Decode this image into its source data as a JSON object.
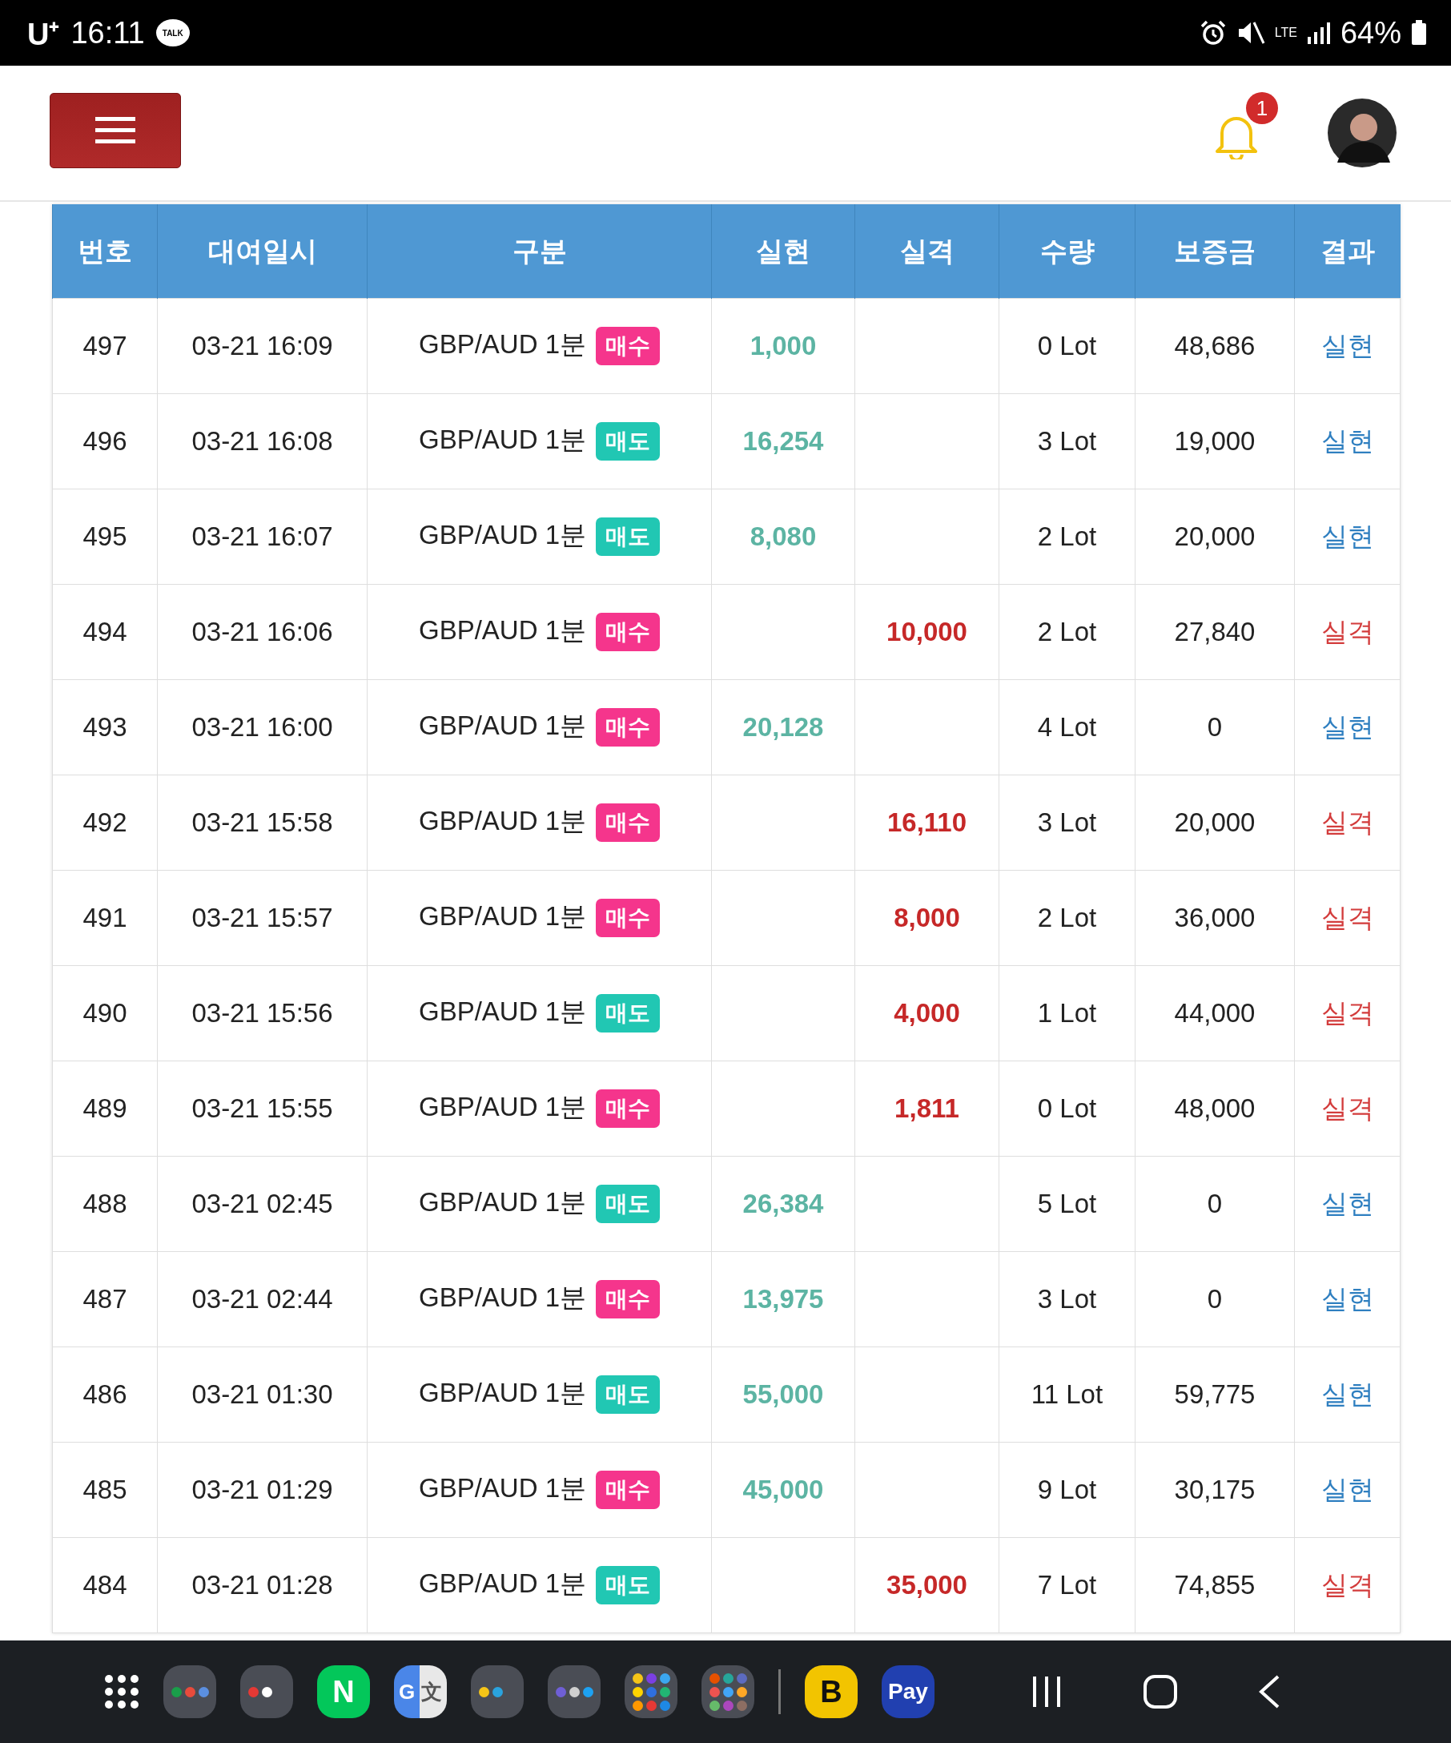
{
  "status_bar": {
    "carrier": "U⁺",
    "time": "16:11",
    "chat_badge": "TALK",
    "network": "LTE",
    "battery": "64%"
  },
  "header": {
    "notification_count": "1"
  },
  "table": {
    "columns": [
      "번호",
      "대여일시",
      "구분",
      "실현",
      "실격",
      "수량",
      "보증금",
      "결과"
    ],
    "rows": [
      {
        "no": "497",
        "datetime": "03-21 16:09",
        "instrument": "GBP/AUD 1분",
        "side": {
          "kind": "buy",
          "label": "매수"
        },
        "realized": "1,000",
        "disqualified": "",
        "quantity": "0 Lot",
        "deposit": "48,686",
        "result": {
          "kind": "win",
          "label": "실현"
        }
      },
      {
        "no": "496",
        "datetime": "03-21 16:08",
        "instrument": "GBP/AUD 1분",
        "side": {
          "kind": "sell",
          "label": "매도"
        },
        "realized": "16,254",
        "disqualified": "",
        "quantity": "3 Lot",
        "deposit": "19,000",
        "result": {
          "kind": "win",
          "label": "실현"
        }
      },
      {
        "no": "495",
        "datetime": "03-21 16:07",
        "instrument": "GBP/AUD 1분",
        "side": {
          "kind": "sell",
          "label": "매도"
        },
        "realized": "8,080",
        "disqualified": "",
        "quantity": "2 Lot",
        "deposit": "20,000",
        "result": {
          "kind": "win",
          "label": "실현"
        }
      },
      {
        "no": "494",
        "datetime": "03-21 16:06",
        "instrument": "GBP/AUD 1분",
        "side": {
          "kind": "buy",
          "label": "매수"
        },
        "realized": "",
        "disqualified": "10,000",
        "quantity": "2 Lot",
        "deposit": "27,840",
        "result": {
          "kind": "loss",
          "label": "실격"
        }
      },
      {
        "no": "493",
        "datetime": "03-21 16:00",
        "instrument": "GBP/AUD 1분",
        "side": {
          "kind": "buy",
          "label": "매수"
        },
        "realized": "20,128",
        "disqualified": "",
        "quantity": "4 Lot",
        "deposit": "0",
        "result": {
          "kind": "win",
          "label": "실현"
        }
      },
      {
        "no": "492",
        "datetime": "03-21 15:58",
        "instrument": "GBP/AUD 1분",
        "side": {
          "kind": "buy",
          "label": "매수"
        },
        "realized": "",
        "disqualified": "16,110",
        "quantity": "3 Lot",
        "deposit": "20,000",
        "result": {
          "kind": "loss",
          "label": "실격"
        }
      },
      {
        "no": "491",
        "datetime": "03-21 15:57",
        "instrument": "GBP/AUD 1분",
        "side": {
          "kind": "buy",
          "label": "매수"
        },
        "realized": "",
        "disqualified": "8,000",
        "quantity": "2 Lot",
        "deposit": "36,000",
        "result": {
          "kind": "loss",
          "label": "실격"
        }
      },
      {
        "no": "490",
        "datetime": "03-21 15:56",
        "instrument": "GBP/AUD 1분",
        "side": {
          "kind": "sell",
          "label": "매도"
        },
        "realized": "",
        "disqualified": "4,000",
        "quantity": "1 Lot",
        "deposit": "44,000",
        "result": {
          "kind": "loss",
          "label": "실격"
        }
      },
      {
        "no": "489",
        "datetime": "03-21 15:55",
        "instrument": "GBP/AUD 1분",
        "side": {
          "kind": "buy",
          "label": "매수"
        },
        "realized": "",
        "disqualified": "1,811",
        "quantity": "0 Lot",
        "deposit": "48,000",
        "result": {
          "kind": "loss",
          "label": "실격"
        }
      },
      {
        "no": "488",
        "datetime": "03-21 02:45",
        "instrument": "GBP/AUD 1분",
        "side": {
          "kind": "sell",
          "label": "매도"
        },
        "realized": "26,384",
        "disqualified": "",
        "quantity": "5 Lot",
        "deposit": "0",
        "result": {
          "kind": "win",
          "label": "실현"
        }
      },
      {
        "no": "487",
        "datetime": "03-21 02:44",
        "instrument": "GBP/AUD 1분",
        "side": {
          "kind": "buy",
          "label": "매수"
        },
        "realized": "13,975",
        "disqualified": "",
        "quantity": "3 Lot",
        "deposit": "0",
        "result": {
          "kind": "win",
          "label": "실현"
        }
      },
      {
        "no": "486",
        "datetime": "03-21 01:30",
        "instrument": "GBP/AUD 1분",
        "side": {
          "kind": "sell",
          "label": "매도"
        },
        "realized": "55,000",
        "disqualified": "",
        "quantity": "11 Lot",
        "deposit": "59,775",
        "result": {
          "kind": "win",
          "label": "실현"
        }
      },
      {
        "no": "485",
        "datetime": "03-21 01:29",
        "instrument": "GBP/AUD 1분",
        "side": {
          "kind": "buy",
          "label": "매수"
        },
        "realized": "45,000",
        "disqualified": "",
        "quantity": "9 Lot",
        "deposit": "30,175",
        "result": {
          "kind": "win",
          "label": "실현"
        }
      },
      {
        "no": "484",
        "datetime": "03-21 01:28",
        "instrument": "GBP/AUD 1분",
        "side": {
          "kind": "sell",
          "label": "매도"
        },
        "realized": "",
        "disqualified": "35,000",
        "quantity": "7 Lot",
        "deposit": "74,855",
        "result": {
          "kind": "loss",
          "label": "실격"
        }
      }
    ]
  },
  "dock": [
    {
      "kind": "apps"
    },
    {
      "kind": "folder"
    },
    {
      "kind": "folder"
    },
    {
      "kind": "app",
      "label": "N",
      "color": "#03c75a"
    },
    {
      "kind": "translate",
      "label": "G",
      "label2": "文"
    },
    {
      "kind": "folder"
    },
    {
      "kind": "folder"
    },
    {
      "kind": "folder"
    },
    {
      "kind": "folder"
    },
    {
      "kind": "divider"
    },
    {
      "kind": "app",
      "label": "B",
      "color": "#f2c400"
    },
    {
      "kind": "app",
      "label": "Pay",
      "color": "#2140b0"
    }
  ]
}
